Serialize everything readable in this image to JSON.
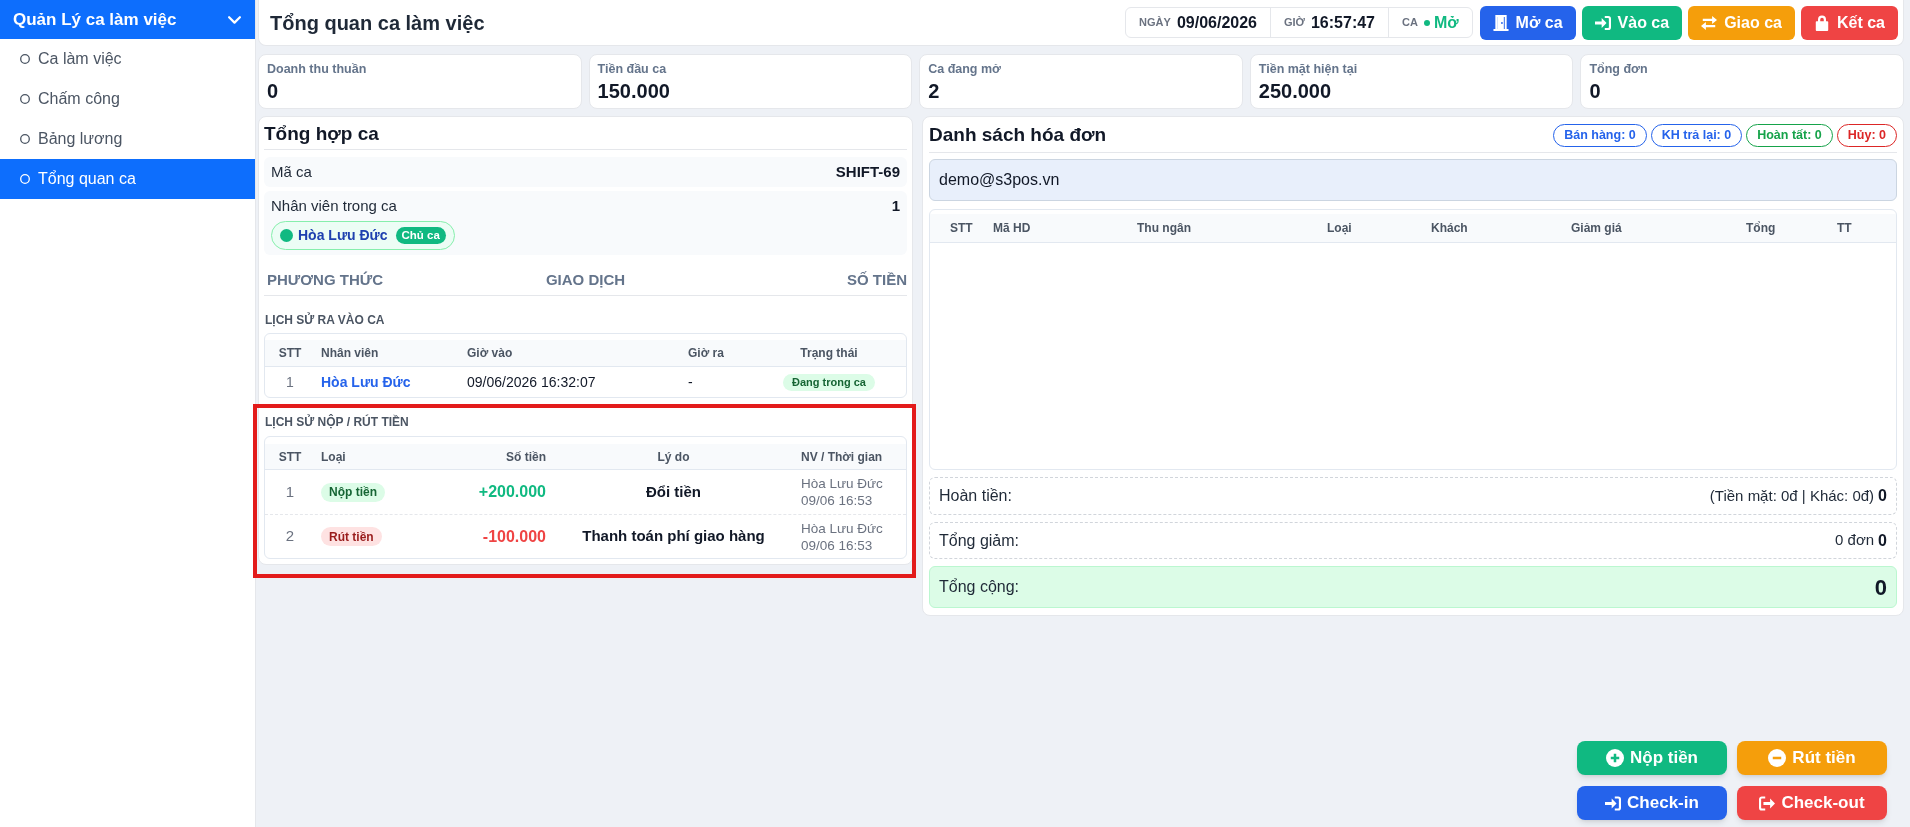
{
  "sidebar": {
    "title": "Quản Lý ca làm việc",
    "expanded": true,
    "items": [
      {
        "text": "Ca làm việc",
        "selected": false
      },
      {
        "text": "Chấm công",
        "selected": false
      },
      {
        "text": "Bảng lương",
        "selected": false
      },
      {
        "text": "Tổng quan ca",
        "selected": true
      }
    ]
  },
  "header": {
    "title": "Tổng quan ca làm việc",
    "info": [
      {
        "kind": "date",
        "label": "NGÀY",
        "value": "09/06/2026"
      },
      {
        "kind": "time",
        "label": "GIỜ",
        "value": "16:57:47"
      },
      {
        "kind": "status",
        "label": "CA",
        "value": "Mở",
        "open": true
      }
    ],
    "buttons": [
      {
        "kind": "open",
        "label": "Mở ca"
      },
      {
        "kind": "checkin",
        "label": "Vào ca"
      },
      {
        "kind": "handover",
        "label": "Giao ca"
      },
      {
        "kind": "close",
        "label": "Kết ca"
      }
    ]
  },
  "stats": [
    {
      "label": "Doanh thu thuần",
      "value": "0"
    },
    {
      "label": "Tiền đầu ca",
      "value": "150.000"
    },
    {
      "label": "Ca đang mở",
      "value": "2"
    },
    {
      "label": "Tiền mặt hiện tại",
      "value": "250.000"
    },
    {
      "label": "Tổng đơn",
      "value": "0"
    }
  ],
  "summary": {
    "title": "Tổng hợp ca",
    "shift_code": {
      "label": "Mã ca",
      "value": "SHIFT-69"
    },
    "staff": {
      "label": "Nhân viên trong ca",
      "count": "1",
      "members": [
        {
          "name": "Hòa Lưu Đức",
          "role": "Chủ ca"
        }
      ]
    },
    "payment_columns": [
      "PHƯƠNG THỨC",
      "GIAO DỊCH",
      "SỐ TIỀN"
    ],
    "attendance": {
      "title": "LỊCH SỬ RA VÀO CA",
      "columns": [
        "STT",
        "Nhân viên",
        "Giờ vào",
        "Giờ ra",
        "Trạng thái"
      ],
      "rows": [
        {
          "stt": "1",
          "employee": "Hòa Lưu Đức",
          "check_in": "09/06/2026 16:32:07",
          "check_out": "-",
          "status": "Đang trong ca"
        }
      ]
    },
    "cash_history": {
      "title": "LỊCH SỬ NỘP / RÚT TIỀN",
      "highlighted": true,
      "columns": [
        "STT",
        "Loại",
        "Số tiền",
        "Lý do",
        "NV / Thời gian"
      ],
      "rows": [
        {
          "stt": "1",
          "kind": "deposit",
          "type": "Nộp tiền",
          "amount": "+200.000",
          "reason": "Đổi tiền",
          "staff": "Hòa Lưu Đức",
          "time": "09/06 16:53"
        },
        {
          "stt": "2",
          "kind": "withdraw",
          "type": "Rút tiền",
          "amount": "-100.000",
          "reason": "Thanh toán phí giao hàng",
          "staff": "Hòa Lưu Đức",
          "time": "09/06 16:53"
        }
      ]
    }
  },
  "invoices": {
    "title": "Danh sách hóa đơn",
    "counters": [
      {
        "label": "Bán hàng: 0",
        "color": "#2563eb"
      },
      {
        "label": "KH trả lại: 0",
        "color": "#2563eb"
      },
      {
        "label": "Hoàn tất: 0",
        "color": "#16a34a"
      },
      {
        "label": "Hủy: 0",
        "color": "#dc2626"
      }
    ],
    "cashier": {
      "value": "demo@s3pos.vn"
    },
    "columns": [
      "STT",
      "Mã HD",
      "Thu ngân",
      "Loại",
      "Khách",
      "Giảm giá",
      "Tổng",
      "TT"
    ],
    "totals": [
      {
        "kind": "refund",
        "label": "Hoàn tiền:",
        "detail": "(Tiền mặt: 0đ | Khác: 0đ)",
        "value": "0"
      },
      {
        "kind": "discount",
        "label": "Tổng giảm:",
        "detail": "0 đơn",
        "value": "0"
      },
      {
        "kind": "total",
        "label": "Tổng cộng:",
        "value": "0"
      }
    ]
  },
  "actions": [
    {
      "kind": "deposit",
      "label": "Nộp tiền"
    },
    {
      "kind": "withdraw",
      "label": "Rút tiền"
    },
    {
      "kind": "checkin",
      "label": "Check-in"
    },
    {
      "kind": "checkout",
      "label": "Check-out"
    }
  ]
}
